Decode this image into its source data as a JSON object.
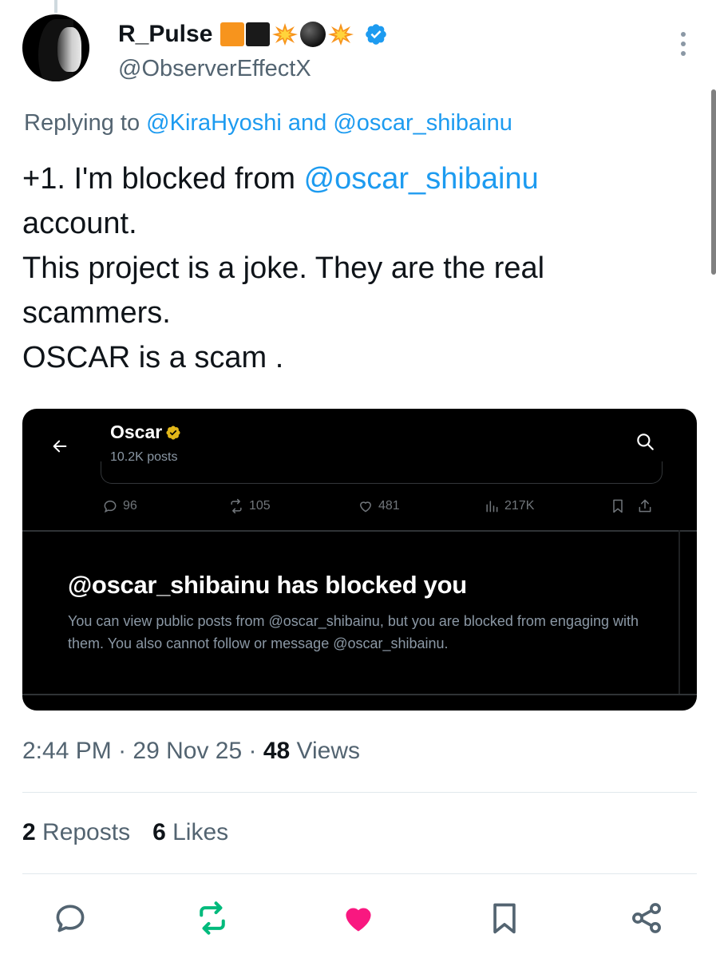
{
  "author": {
    "display_name": "R_Pulse",
    "handle": "@ObserverEffectX"
  },
  "replying": {
    "prefix": "Replying to ",
    "user1": "@KiraHyoshi",
    "and": " and ",
    "user2": "@oscar_shibainu"
  },
  "tweet": {
    "line1_text": "+1. I'm blocked from ",
    "line1_mention": "@oscar_shibainu",
    "line2": "account.",
    "line3": "This project is a joke. They are the real",
    "line4": "scammers.",
    "line5": "OSCAR is a scam ."
  },
  "media": {
    "profile_name": "Oscar",
    "posts_count": "10.2K posts",
    "stats": {
      "replies": "96",
      "reposts": "105",
      "likes": "481",
      "views": "217K"
    },
    "block_title": "@oscar_shibainu has blocked you",
    "block_description": "You can view public posts from @oscar_shibainu, but you are blocked from engaging with them. You also cannot follow or message @oscar_shibainu."
  },
  "meta": {
    "time": "2:44 PM",
    "sep1": " · ",
    "date": "29 Nov 25",
    "sep2": " · ",
    "views_count": "48",
    "views_label": " Views"
  },
  "engagement": {
    "reposts_count": "2",
    "reposts_label": " Reposts",
    "likes_count": "6",
    "likes_label": " Likes"
  },
  "colors": {
    "accent": "#1d9bf0",
    "repost_green": "#00ba7c",
    "like_pink": "#f91880",
    "muted": "#536471"
  }
}
